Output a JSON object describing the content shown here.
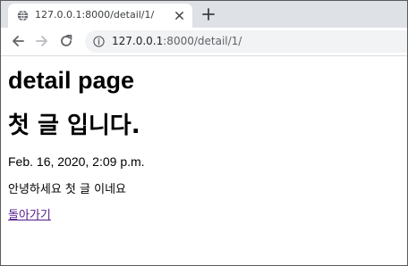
{
  "browser": {
    "tab": {
      "title": "127.0.0.1:8000/detail/1/"
    },
    "address": {
      "host": "127.0.0.1",
      "path": ":8000/detail/1/"
    },
    "icons": {
      "favicon": "globe-icon",
      "tab_close": "close-icon",
      "new_tab": "plus-icon",
      "back": "arrow-left-icon",
      "forward": "arrow-right-icon",
      "reload": "reload-icon",
      "site_info": "info-icon"
    }
  },
  "page": {
    "heading": "detail page",
    "post_title": "첫 글 입니다.",
    "post_date": "Feb. 16, 2020, 2:09 p.m.",
    "post_body": "안녕하세요 첫 글 이네요",
    "back_link": "돌아가기"
  },
  "colors": {
    "tab_strip": "#dee1e6",
    "omnibox": "#f1f3f4",
    "visited_link": "#551a8b"
  }
}
